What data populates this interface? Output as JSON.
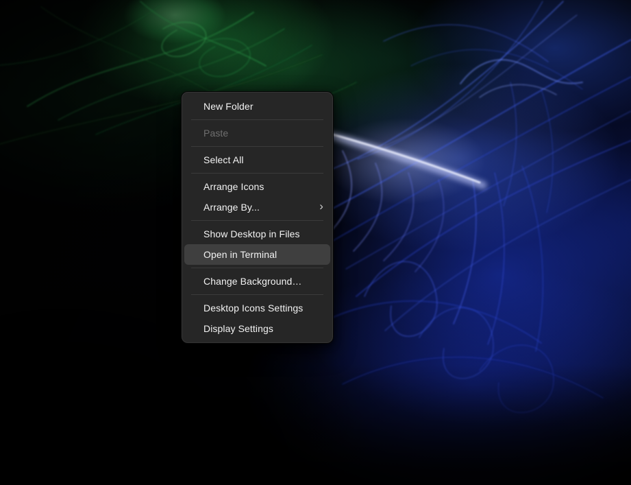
{
  "wallpaper": {
    "description": "dark abstract light-painting wallpaper: green fiber streaks in the top-left, dense blue fiber streaks and a bright lavender band on the right, fading to black in the bottom-left corner",
    "palette": {
      "background": "#010102",
      "green_glow": "#28aa4b",
      "green_dark": "#145526",
      "blue_glow": "#2040dc",
      "blue_fiber": "#3d5cf0",
      "bright_band": "#e8edff"
    }
  },
  "context_menu": {
    "submenu_arrow_glyph": "›",
    "colors": {
      "background": "#262626",
      "separator": "#3b3b3b",
      "text": "#f3f3f3",
      "text_disabled": "#6f6f6f",
      "highlight_background": "#3f3f3f"
    },
    "groups": [
      {
        "items": [
          {
            "label": "New Folder",
            "state": "normal"
          }
        ]
      },
      {
        "items": [
          {
            "label": "Paste",
            "state": "disabled"
          }
        ]
      },
      {
        "items": [
          {
            "label": "Select All",
            "state": "normal"
          }
        ]
      },
      {
        "items": [
          {
            "label": "Arrange Icons",
            "state": "normal"
          },
          {
            "label": "Arrange By...",
            "state": "normal",
            "has_submenu": true
          }
        ]
      },
      {
        "items": [
          {
            "label": "Show Desktop in Files",
            "state": "normal"
          },
          {
            "label": "Open in Terminal",
            "state": "highlighted"
          }
        ]
      },
      {
        "items": [
          {
            "label": "Change Background…",
            "state": "normal"
          }
        ]
      },
      {
        "items": [
          {
            "label": "Desktop Icons Settings",
            "state": "normal"
          },
          {
            "label": "Display Settings",
            "state": "normal"
          }
        ]
      }
    ]
  }
}
